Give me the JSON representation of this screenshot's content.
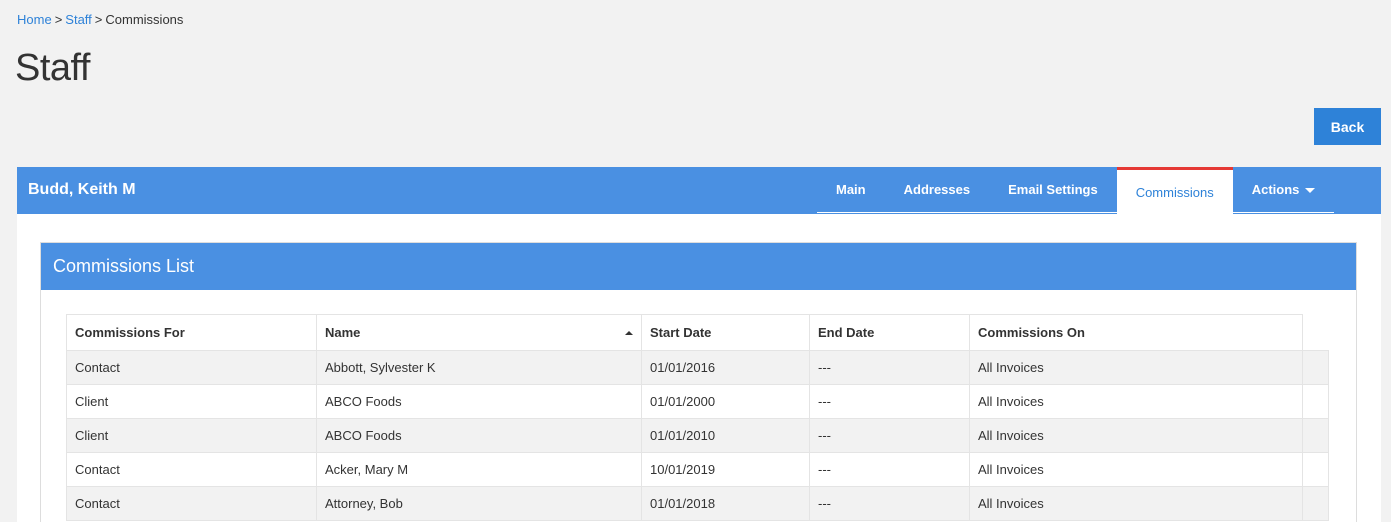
{
  "breadcrumb": {
    "home": "Home",
    "staff": "Staff",
    "current": "Commissions",
    "sep": ">"
  },
  "page_title": "Staff",
  "back_button": "Back",
  "record": {
    "name": "Budd, Keith M",
    "tabs": [
      {
        "label": "Main"
      },
      {
        "label": "Addresses"
      },
      {
        "label": "Email Settings"
      },
      {
        "label": "Commissions",
        "active": true
      },
      {
        "label": "Actions"
      }
    ]
  },
  "commissions": {
    "title": "Commissions List",
    "columns": [
      "Commissions For",
      "Name",
      "Start Date",
      "End Date",
      "Commissions On"
    ],
    "rows": [
      [
        "Contact",
        "Abbott, Sylvester K",
        "01/01/2016",
        "---",
        "All Invoices"
      ],
      [
        "Client",
        "ABCO Foods",
        "01/01/2000",
        "---",
        "All Invoices"
      ],
      [
        "Client",
        "ABCO Foods",
        "01/01/2010",
        "---",
        "All Invoices"
      ],
      [
        "Contact",
        "Acker, Mary M",
        "10/01/2019",
        "---",
        "All Invoices"
      ],
      [
        "Contact",
        "Attorney, Bob",
        "01/01/2018",
        "---",
        "All Invoices"
      ]
    ]
  },
  "colors": {
    "accent": "#4a90e2",
    "link": "#2e82d8",
    "active_tab_border": "#e53935"
  }
}
